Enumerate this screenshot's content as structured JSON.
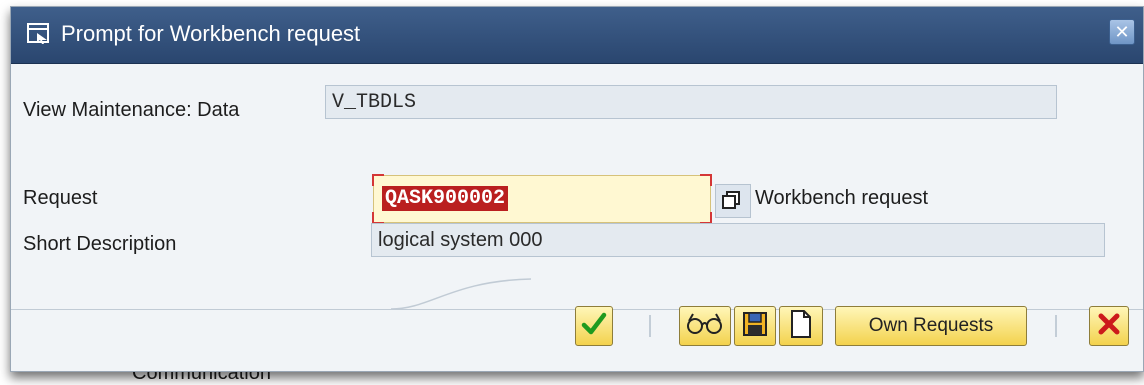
{
  "background_text": "Communication",
  "dialog": {
    "title": "Prompt for Workbench request",
    "close_icon": "close-x-icon"
  },
  "fields": {
    "view_label": "View Maintenance: Data",
    "view_value": "V_TBDLS",
    "request_label": "Request",
    "request_value": "QASK900002",
    "request_type": "Workbench request",
    "short_desc_label": "Short Description",
    "short_desc_value": "logical system 000"
  },
  "buttons": {
    "confirm_icon": "checkmark-icon",
    "find_icon": "glasses-icon",
    "save_icon": "save-icon",
    "create_icon": "new-document-icon",
    "own_requests_label": "Own Requests",
    "cancel_icon": "cancel-icon"
  },
  "colors": {
    "titlebar": "#2f4f7e",
    "error_highlight": "#ba1f1f",
    "button_yellow": "#f3d24d",
    "confirm_green": "#1f9a1f",
    "cancel_red": "#cc1b1b"
  }
}
